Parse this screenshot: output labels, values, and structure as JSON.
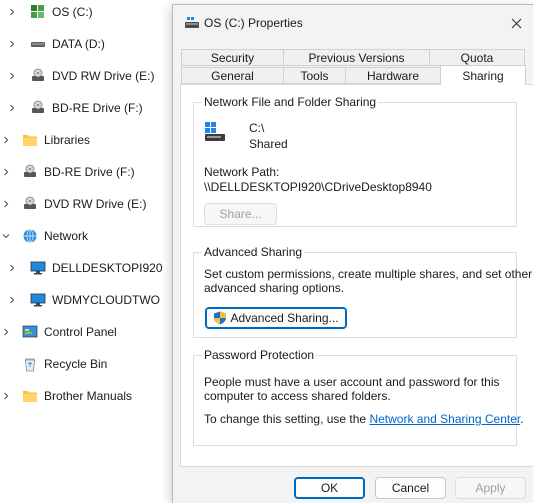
{
  "tree": {
    "items": [
      {
        "label": "OS (C:)",
        "icon": "windows-drive-icon"
      },
      {
        "label": "DATA (D:)",
        "icon": "drive-icon"
      },
      {
        "label": "DVD RW Drive (E:)",
        "icon": "dvd-drive-icon"
      },
      {
        "label": "BD-RE Drive (F:)",
        "icon": "bd-drive-icon"
      },
      {
        "label": "Libraries",
        "icon": "folder-icon"
      },
      {
        "label": "BD-RE Drive (F:)",
        "icon": "bd-drive-icon"
      },
      {
        "label": "DVD RW Drive (E:)",
        "icon": "dvd-drive-icon"
      },
      {
        "label": "Network",
        "icon": "network-icon"
      },
      {
        "label": "DELLDESKTOPI920",
        "icon": "computer-icon"
      },
      {
        "label": "WDMYCLOUDTWO",
        "icon": "computer-icon"
      },
      {
        "label": "Control Panel",
        "icon": "control-panel-icon"
      },
      {
        "label": "Recycle Bin",
        "icon": "recycle-bin-icon"
      },
      {
        "label": "Brother Manuals",
        "icon": "folder-icon"
      }
    ]
  },
  "dialog": {
    "title": "OS (C:) Properties",
    "tabs_row1": [
      "Security",
      "Previous Versions",
      "Quota"
    ],
    "tabs_row2": [
      "General",
      "Tools",
      "Hardware",
      "Sharing"
    ],
    "active_tab": "Sharing",
    "network_sharing": {
      "title": "Network File and Folder Sharing",
      "drive_name": "C:\\",
      "drive_status": "Shared",
      "path_label": "Network Path:",
      "path_value": "\\\\DELLDESKTOPI920\\CDriveDesktop8940",
      "share_button": "Share..."
    },
    "advanced_sharing": {
      "title": "Advanced Sharing",
      "description_line1": "Set custom permissions, create multiple shares, and set other",
      "description_line2": "advanced sharing options.",
      "button": "Advanced Sharing..."
    },
    "password_protection": {
      "title": "Password Protection",
      "line1": "People must have a user account and password for this",
      "line2": "computer to access shared folders.",
      "line3_prefix": "To change this setting, use the ",
      "link": "Network and Sharing Center",
      "line3_suffix": "."
    },
    "footer": {
      "ok": "OK",
      "cancel": "Cancel",
      "apply": "Apply"
    }
  },
  "colors": {
    "accent": "#0067c0",
    "link": "#0066cc",
    "folder": "#f6c34a"
  }
}
